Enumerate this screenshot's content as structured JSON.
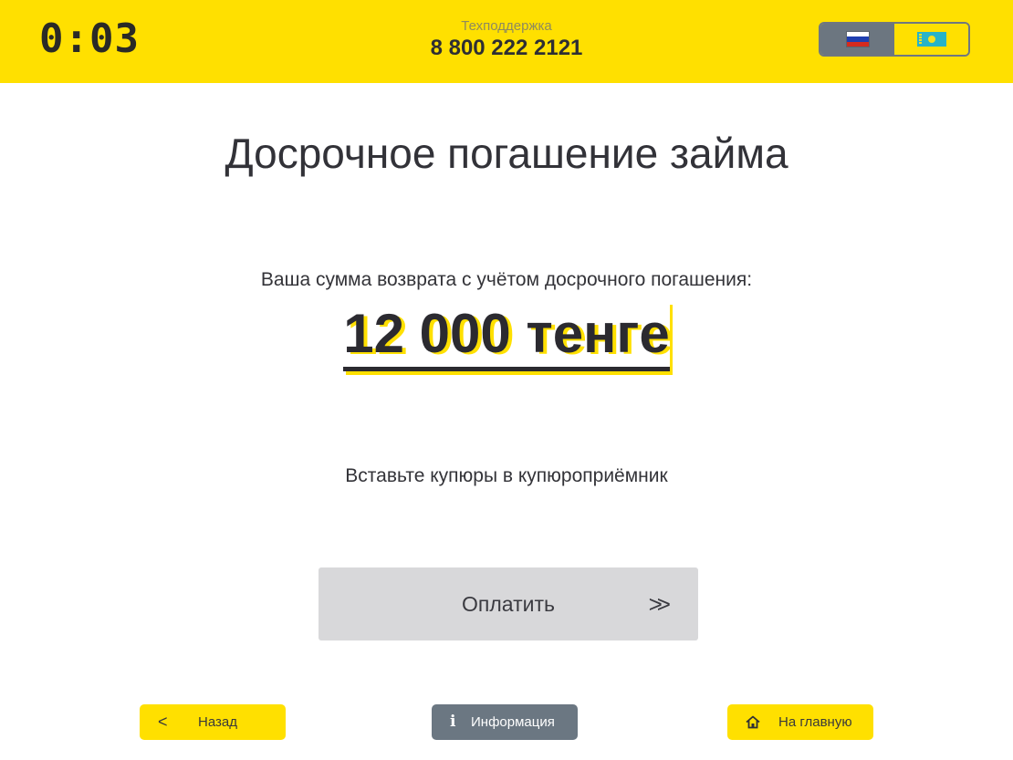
{
  "header": {
    "timer": "0:03",
    "support_label": "Техподдержка",
    "support_phone": "8 800 222 2121",
    "languages": [
      {
        "code": "ru",
        "icon": "russia-flag-icon",
        "active": true
      },
      {
        "code": "kz",
        "icon": "kazakhstan-flag-icon",
        "active": false
      }
    ]
  },
  "main": {
    "title": "Досрочное погашение займа",
    "amount_label": "Ваша сумма возврата с учётом досрочного погашения:",
    "amount": "12 000 тенге",
    "instruction": "Вставьте купюры в купюроприёмник",
    "pay_button": "Оплатить",
    "pay_arrows": ">>"
  },
  "footer": {
    "back_label": "Назад",
    "back_icon": "<",
    "info_label": "Информация",
    "info_icon": "i",
    "home_label": "На главную"
  },
  "colors": {
    "accent": "#ffe000",
    "gray_button": "#d8d8da",
    "slate": "#6b7782",
    "text": "#2f2f35"
  }
}
